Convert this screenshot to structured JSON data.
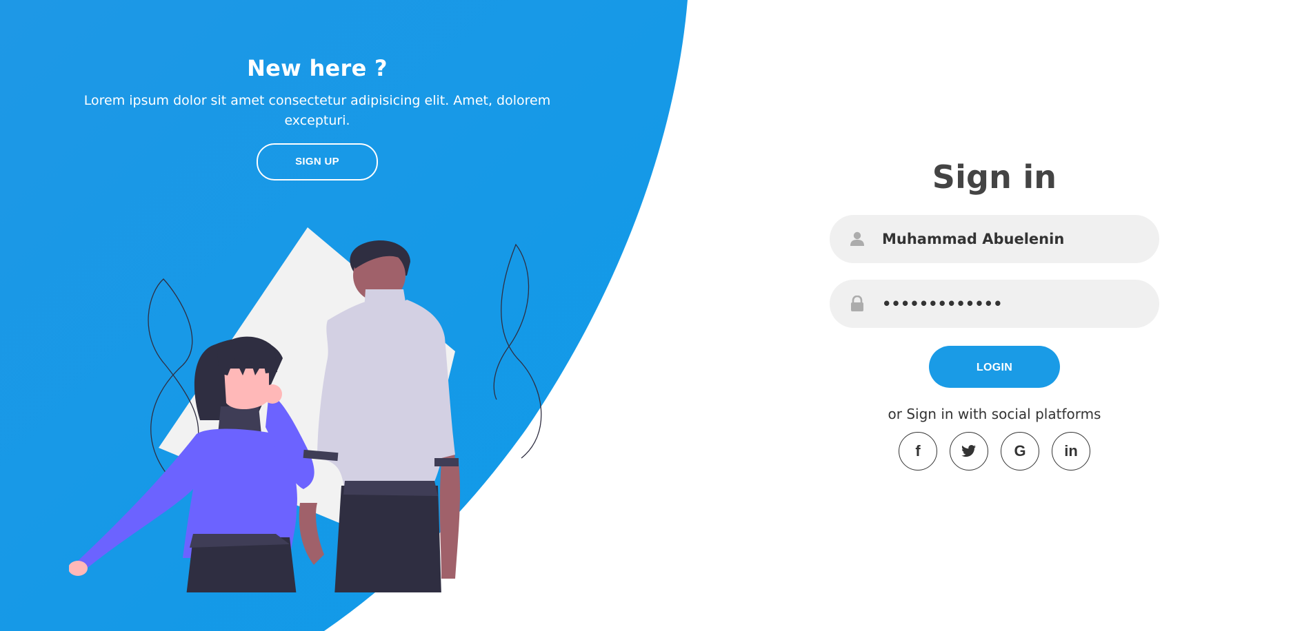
{
  "colors": {
    "accent": "#1a9be6",
    "panel_blue": "#1a9be6",
    "field_bg": "#f0f0f0",
    "title_text": "#444444",
    "illustration_purple": "#6c63ff",
    "illustration_dark": "#2f2e41",
    "illustration_light": "#d3d0e3",
    "illustration_skin": "#a0616a",
    "illustration_skin_light": "#ffb8b8",
    "illustration_bg_shape": "#f2f2f2"
  },
  "promo": {
    "title": "New here ?",
    "text": "Lorem ipsum dolor sit amet consectetur adipisicing elit. Amet, dolorem excepturi.",
    "signup_label": "SIGN UP"
  },
  "signin": {
    "title": "Sign in",
    "username": {
      "value": "Muhammad Abuelenin",
      "icon": "user-icon"
    },
    "password": {
      "value": "•••••••••••••",
      "icon": "lock-icon"
    },
    "login_label": "LOGIN",
    "social_text": "or Sign in with social platforms",
    "socials": [
      {
        "name": "facebook",
        "glyph": "f",
        "icon": "facebook-icon"
      },
      {
        "name": "twitter",
        "glyph": "",
        "icon": "twitter-icon"
      },
      {
        "name": "google",
        "glyph": "G",
        "icon": "google-icon"
      },
      {
        "name": "linkedin",
        "glyph": "in",
        "icon": "linkedin-icon"
      }
    ]
  }
}
